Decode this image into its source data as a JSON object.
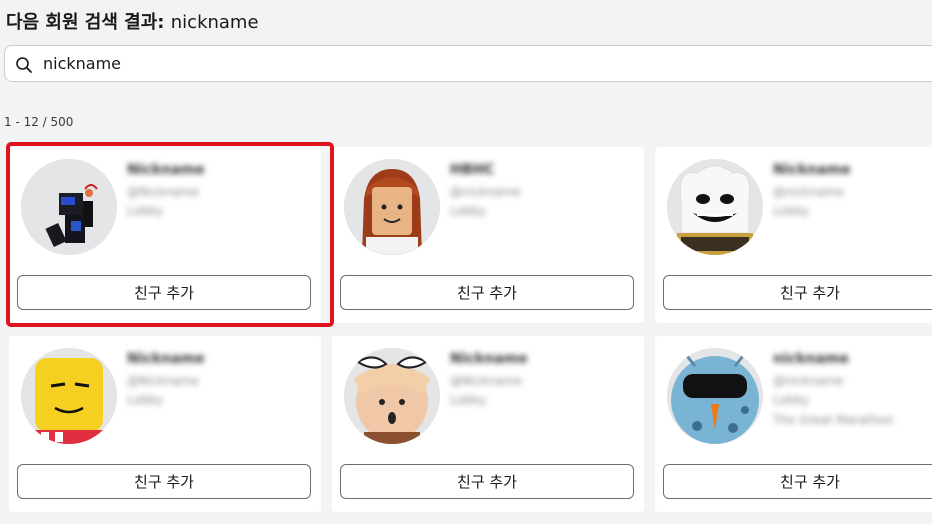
{
  "header": {
    "title_prefix": "다음 회원 검색 결과:",
    "query": "nickname"
  },
  "search": {
    "value": "nickname",
    "icon": "search-icon"
  },
  "results": {
    "count_label": "1 - 12 / 500",
    "add_friend_label": "친구 추가",
    "cards": [
      {
        "name": "Nickname",
        "username": "@Nickname",
        "status": "Lobby"
      },
      {
        "name": "HBHC",
        "username": "@nickname",
        "status": "Lobby"
      },
      {
        "name": "Nickname",
        "username": "@nickname",
        "status": "Lobby"
      },
      {
        "name": "Nickname",
        "username": "@Nickname",
        "status": "Lobby"
      },
      {
        "name": "Nickname",
        "username": "@Nickname",
        "status": "Lobby"
      },
      {
        "name": "nickname",
        "username": "@nickname",
        "status": "Lobby",
        "game": "The Great Marathon"
      }
    ]
  },
  "colors": {
    "highlight": "#e0141c",
    "background": "#f2f3f4"
  }
}
